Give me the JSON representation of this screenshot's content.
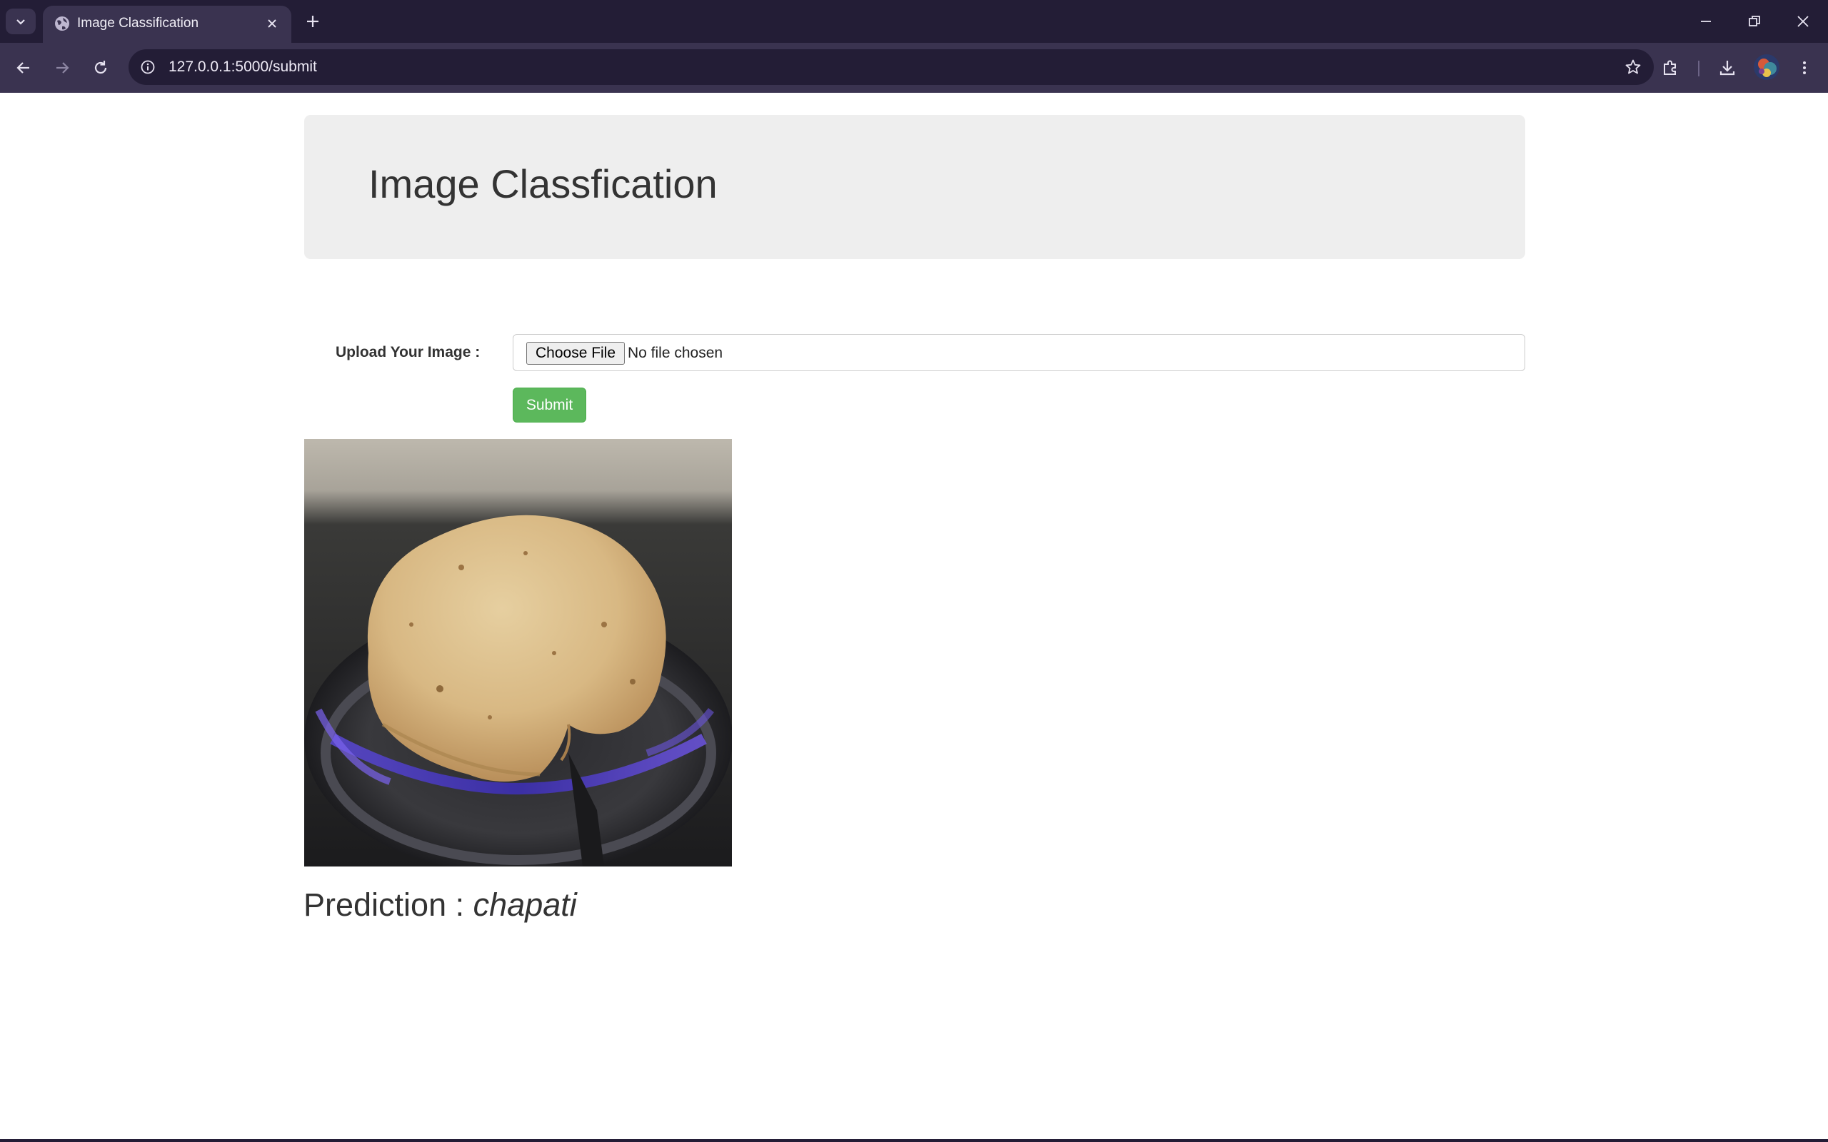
{
  "browser": {
    "tab_title": "Image Classification",
    "url": "127.0.0.1:5000/submit"
  },
  "header": {
    "title": "Image Classfication"
  },
  "form": {
    "upload_label": "Upload Your Image :",
    "choose_file_label": "Choose File",
    "file_status": "No file chosen",
    "submit_label": "Submit"
  },
  "result": {
    "prediction_prefix": "Prediction :",
    "prediction_value": "chapati"
  },
  "colors": {
    "chrome_dark": "#231d36",
    "chrome_toolbar": "#3a3350",
    "submit_green": "#5cb85c",
    "jumbotron_bg": "#eeeeee"
  },
  "icons": [
    "tab-list-icon",
    "globe-icon",
    "close-icon",
    "plus-icon",
    "minimize-icon",
    "restore-icon",
    "back-arrow-icon",
    "forward-arrow-icon",
    "reload-icon",
    "info-icon",
    "star-icon",
    "extensions-icon",
    "download-icon",
    "kebab-menu-icon"
  ]
}
